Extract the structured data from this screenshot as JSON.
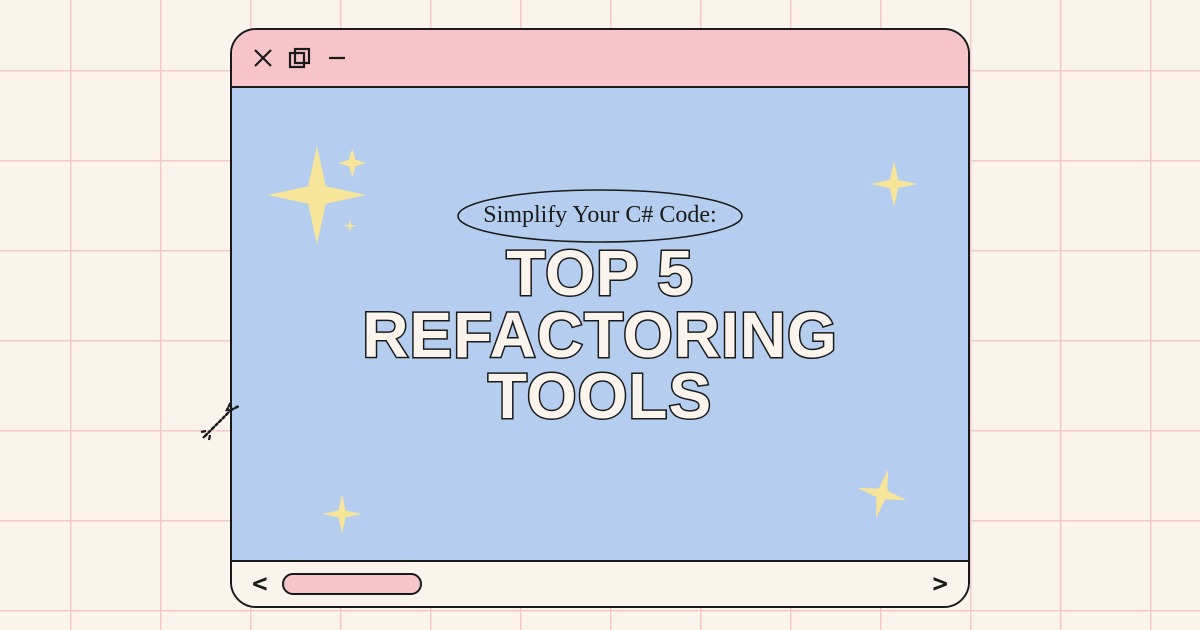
{
  "subtitle": "Simplify Your C# Code:",
  "title": "TOP 5\nREFACTORING\nTOOLS",
  "footer": {
    "prev": "<",
    "next": ">"
  }
}
